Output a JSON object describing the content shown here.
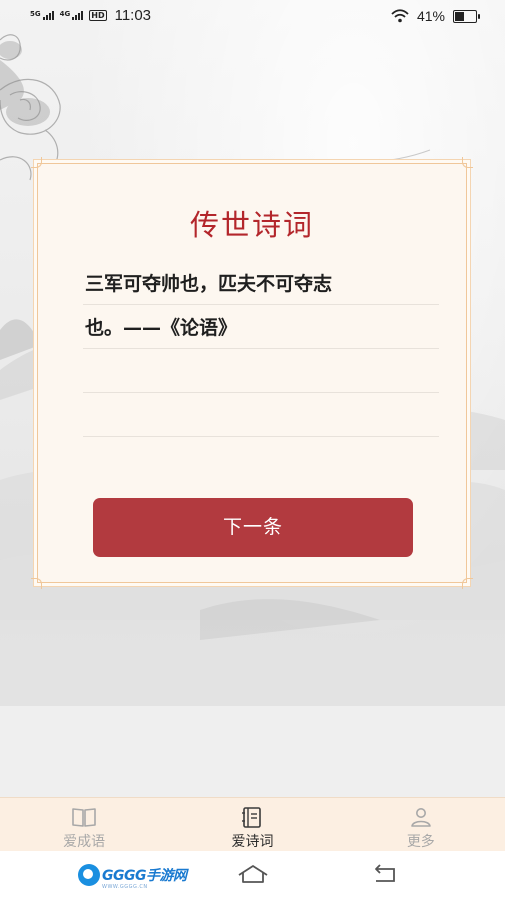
{
  "status_bar": {
    "net1": "5G",
    "net2": "4G",
    "hd": "HD",
    "time": "11:03",
    "battery_text": "41%",
    "battery_level": 0.41
  },
  "card": {
    "title": "传世诗词",
    "lines": [
      "三军可夺帅也，匹夫不可夺志",
      "也。——《论语》",
      "",
      ""
    ],
    "next_button": "下一条"
  },
  "tabs": [
    {
      "label": "爱成语",
      "icon": "book-icon",
      "active": false
    },
    {
      "label": "爱诗词",
      "icon": "notebook-icon",
      "active": true
    },
    {
      "label": "更多",
      "icon": "user-icon",
      "active": false
    }
  ],
  "watermark": {
    "brand": "GGGG手游网",
    "url": "WWW.GGGG.CN"
  },
  "colors": {
    "accent": "#b23a3f",
    "title": "#b3262b",
    "tabbar_bg": "#fcefe2"
  }
}
